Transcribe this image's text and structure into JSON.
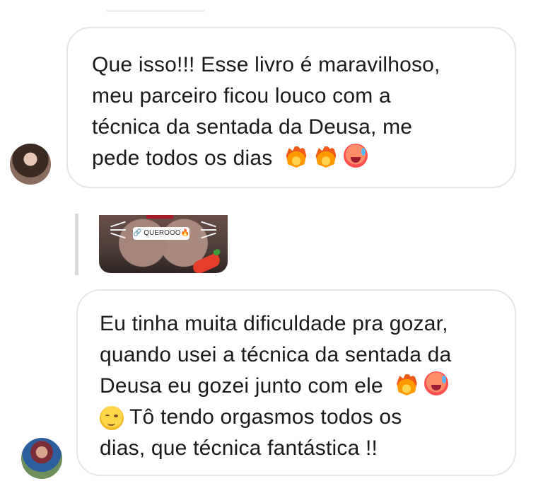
{
  "messages": [
    {
      "lines": [
        "Que isso!!! Esse livro é maravilhoso,",
        "meu parceiro ficou louco com a",
        "técnica da sentada da Deusa, me",
        "pede todos os dias"
      ],
      "emoji": [
        "fire-icon",
        "fire-icon",
        "hot-face-icon"
      ]
    },
    {
      "lines": [
        "Eu tinha muita dificuldade pra gozar,",
        "quando usei a técnica da sentada da",
        "Deusa eu gozei junto com ele",
        "Tô tendo orgasmos todos os",
        "dias, que técnica fantástica !!"
      ],
      "emoji_line_3": [
        "fire-icon",
        "hot-face-icon"
      ],
      "emoji_line_4": [
        "relieved-face-icon"
      ]
    }
  ],
  "story_reply": {
    "tag": "🔗 QUEROOO🔥"
  }
}
